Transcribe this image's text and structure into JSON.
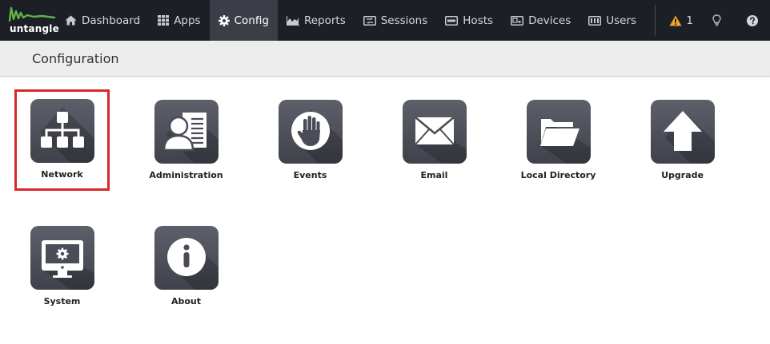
{
  "app": {
    "logo_text": "untangle"
  },
  "nav": [
    {
      "key": "dashboard",
      "label": "Dashboard",
      "icon": "home-icon",
      "active": false
    },
    {
      "key": "apps",
      "label": "Apps",
      "icon": "grid-icon",
      "active": false
    },
    {
      "key": "config",
      "label": "Config",
      "icon": "gear-icon",
      "active": true
    },
    {
      "key": "reports",
      "label": "Reports",
      "icon": "area-chart-icon",
      "active": false
    },
    {
      "key": "sessions",
      "label": "Sessions",
      "icon": "sessions-icon",
      "active": false
    },
    {
      "key": "hosts",
      "label": "Hosts",
      "icon": "hosts-icon",
      "active": false
    },
    {
      "key": "devices",
      "label": "Devices",
      "icon": "devices-icon",
      "active": false
    },
    {
      "key": "users",
      "label": "Users",
      "icon": "users-icon",
      "active": false
    }
  ],
  "utilities": {
    "alerts_count": "1",
    "alerts_icon": "warning-icon",
    "bulb_icon": "lightbulb-icon",
    "help_icon": "help-icon"
  },
  "page": {
    "title": "Configuration"
  },
  "tiles": [
    {
      "key": "network",
      "label": "Network",
      "icon": "network-icon",
      "selected": true
    },
    {
      "key": "administration",
      "label": "Administration",
      "icon": "administration-icon",
      "selected": false
    },
    {
      "key": "events",
      "label": "Events",
      "icon": "events-hand-icon",
      "selected": false
    },
    {
      "key": "email",
      "label": "Email",
      "icon": "email-envelope-icon",
      "selected": false
    },
    {
      "key": "local_directory",
      "label": "Local Directory",
      "icon": "folder-icon",
      "selected": false
    },
    {
      "key": "upgrade",
      "label": "Upgrade",
      "icon": "upgrade-arrow-icon",
      "selected": false
    },
    {
      "key": "system",
      "label": "System",
      "icon": "system-monitor-icon",
      "selected": false
    },
    {
      "key": "about",
      "label": "About",
      "icon": "info-icon",
      "selected": false
    }
  ],
  "colors": {
    "topbar": "#1d1f27",
    "active_nav": "#3c3e47",
    "logo_green": "#5db346",
    "warning": "#f5a623",
    "selection_outline": "#d9262b",
    "tile_gradient_top": "#5d5f6a",
    "tile_gradient_bottom": "#3f414b"
  }
}
